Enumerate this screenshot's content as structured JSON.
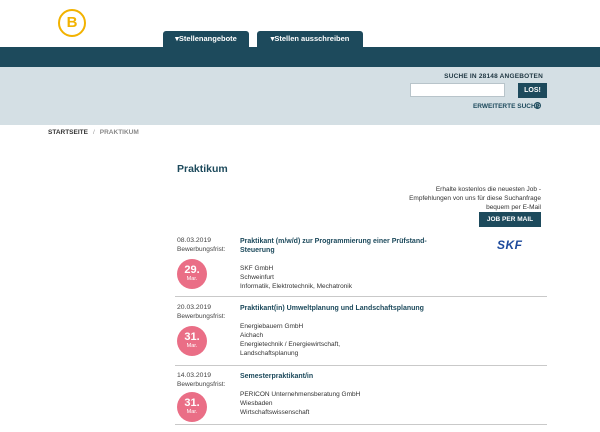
{
  "header": {
    "logo_letter": "B",
    "tabs": [
      "▾Stellenangebote",
      "▾Stellen ausschreiben"
    ],
    "search_caption": "SUCHE IN 28148 ANGEBOTEN",
    "search_placeholder": "",
    "search_button": "LOS!",
    "advanced_search": "ERWEITERTE SUCHE"
  },
  "breadcrumb": {
    "home": "STARTSEITE",
    "separator": "/",
    "current": "PRAKTIKUM"
  },
  "page_title": "Praktikum",
  "promo": {
    "text": "Erhalte kostenlos die neuesten Job - Empfehlungen von uns für diese Suchanfrage bequem per E-Mail",
    "button": "JOB PER MAIL"
  },
  "jobs": [
    {
      "date": "08.03.2019",
      "deadline_label": "Bewerbungsfrist:",
      "deadline_day": "29.",
      "deadline_month": "Mar.",
      "title": "Praktikant (m/w/d) zur Programmierung einer Prüfstand-Steuerung",
      "company": "SKF GmbH",
      "location": "Schweinfurt",
      "fields": "Informatik, Elektrotechnik, Mechatronik",
      "logo": "SKF"
    },
    {
      "date": "20.03.2019",
      "deadline_label": "Bewerbungsfrist:",
      "deadline_day": "31.",
      "deadline_month": "Mar.",
      "title": "Praktikant(in) Umweltplanung und Landschaftsplanung",
      "company": "Energiebauern GmbH",
      "location": "Aichach",
      "fields": "Energietechnik / Energiewirtschaft, Landschaftsplanung"
    },
    {
      "date": "14.03.2019",
      "deadline_label": "Bewerbungsfrist:",
      "deadline_day": "31.",
      "deadline_month": "Mar.",
      "title": "Semesterpraktikant/in",
      "company": "PERICON Unternehmensberatung GmbH",
      "location": "Wiesbaden",
      "fields": "Wirtschaftswissenschaft"
    }
  ],
  "colors": {
    "brand": "#1d4a5c",
    "accent": "#f2b200",
    "badge": "#ea6e86",
    "search_band": "#d4dfe4"
  }
}
